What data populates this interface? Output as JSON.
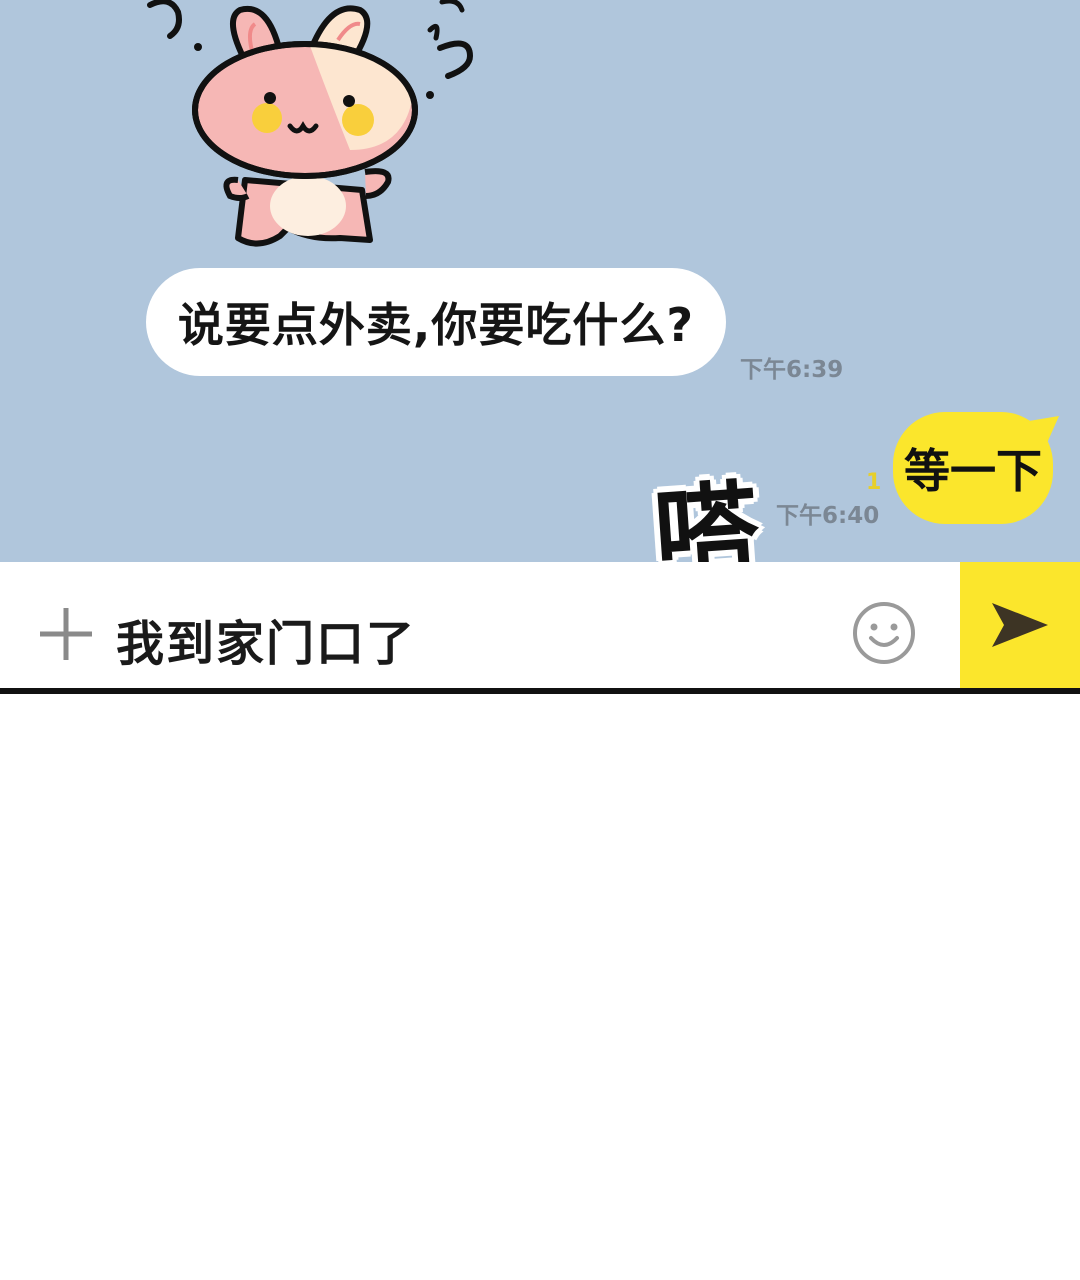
{
  "messages": [
    {
      "side": "left",
      "text": "说要点外卖,你要吃什么?",
      "time": "下午6:39"
    },
    {
      "side": "right",
      "text": "等一下",
      "time": "下午6:40",
      "unread": "1"
    }
  ],
  "sound_effect": "嗒",
  "input": {
    "value": "我到家门口了"
  },
  "icons": {
    "add": "plus-icon",
    "emoji": "smiley-icon",
    "send": "send-arrow-icon"
  },
  "colors": {
    "chat_background": "#b0c6dc",
    "outgoing_bubble": "#fbe62c",
    "send_button": "#fbe62c"
  }
}
